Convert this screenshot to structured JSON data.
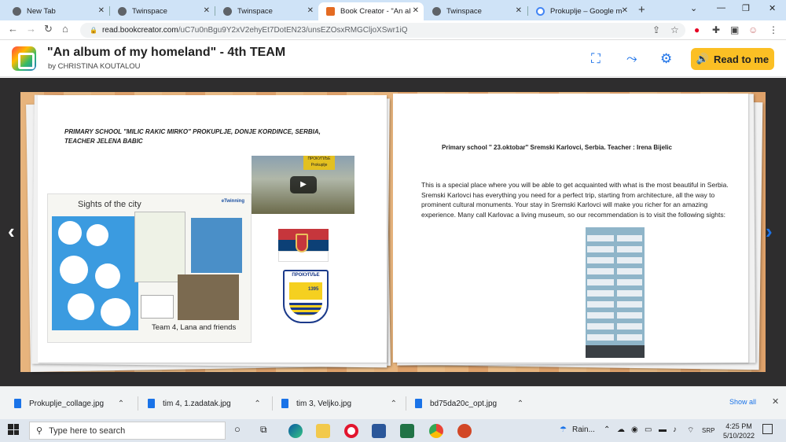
{
  "browser": {
    "tabs": [
      {
        "label": "New Tab",
        "fav_color": "#5f6368"
      },
      {
        "label": "Twinspace",
        "fav_color": "#5f6368"
      },
      {
        "label": "Twinspace",
        "fav_color": "#5f6368"
      },
      {
        "label": "Book Creator - \"An al",
        "fav_color": "#e46b22",
        "active": true
      },
      {
        "label": "Twinspace",
        "fav_color": "#5f6368"
      },
      {
        "label": "Prokuplje – Google m",
        "fav_color": "#4285f4"
      }
    ],
    "url_host": "read.bookcreator.com",
    "url_path": "/uC7u0nBgu9Y2xV2ehyEt7DotEN23/unsEZOsxRMGCljoXSwr1iQ"
  },
  "book": {
    "title": "\"An album of my homeland\" - 4th TEAM",
    "author": "by CHRISTINA KOUTALOU",
    "read_button": "Read to me"
  },
  "left_page": {
    "heading": "PRIMARY SCHOOL \"MILIC RAKIC MIRKO\" PROKUPLJE, DONJE KORDINCE, SERBIA, TEACHER JELENA BABIC",
    "collage_title": "Sights of the city",
    "collage_caption": "Team 4, Lana and friends",
    "collage_brand": "eTwinning",
    "video_sign": "ПРОКУПЉЕ Prokuplje",
    "crest_title": "ПРОКУПЉЕ",
    "crest_year": "1395"
  },
  "right_page": {
    "heading": "Primary school '' 23.oktobar'' Sremski Karlovci, Serbia. Teacher : Irena Bijelic",
    "body": "This is a special place where you will be able to get acquainted with what is the most beautiful in Serbia. Sremski Karlovci has everything you need for a perfect trip, starting from architecture, all the way to prominent cultural monuments. Your stay in Sremski Karlovci will make you richer for an amazing experience. Many call Karlovac a living museum, so our recommendation is to visit the following sights:"
  },
  "downloads": {
    "items": [
      {
        "name": "Prokuplje_collage.jpg"
      },
      {
        "name": "tim 4, 1.zadatak.jpg"
      },
      {
        "name": "tim 3, Veljko.jpg"
      },
      {
        "name": "bd75da20c_opt.jpg"
      }
    ],
    "show_all": "Show all"
  },
  "taskbar": {
    "search_placeholder": "Type here to search",
    "weather": "Rain...",
    "lang": "SRP",
    "time": "4:25 PM",
    "date": "5/10/2022"
  }
}
